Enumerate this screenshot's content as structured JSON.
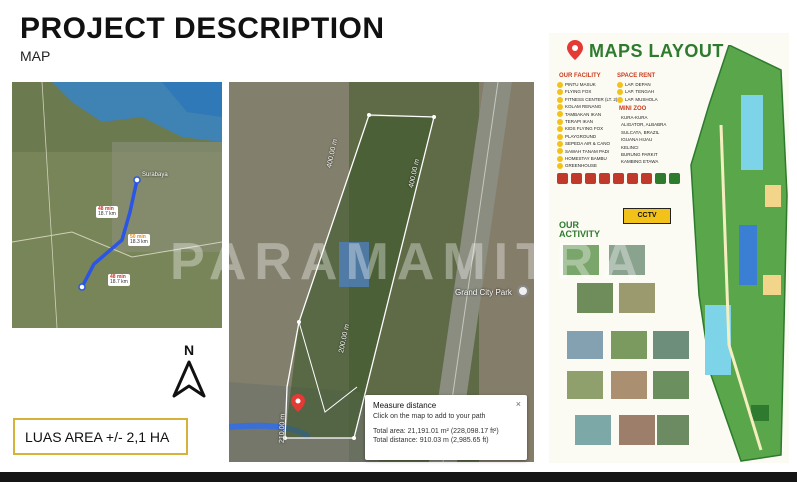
{
  "header": {
    "title": "PROJECT DESCRIPTION",
    "subtitle": "MAP"
  },
  "area_label": "LUAS AREA +/- 2,1 HA",
  "compass": {
    "label": "N"
  },
  "route_map": {
    "city_label": "Surabaya",
    "route_times": [
      {
        "time": "48 min",
        "distance": "18.7 km"
      },
      {
        "time": "50 min",
        "distance": "18.3 km"
      },
      {
        "time": "48 min",
        "distance": "18.7 km"
      }
    ]
  },
  "site_map": {
    "poi_label": "Grand City Park",
    "dimensions": [
      "400.00 m",
      "400.00 m",
      "200.00 m",
      "210.00 m"
    ],
    "measure": {
      "title": "Measure distance",
      "hint": "Click on the map to add to your path",
      "total_area": "Total area: 21,191.01 m² (228,098.17 ft²)",
      "total_distance": "Total distance: 910.03 m (2,985.65 ft)",
      "close": "×"
    }
  },
  "watermark": "PARAMAMITRA",
  "maps_layout": {
    "title": "MAPS LAYOUT",
    "facility_heading": "OUR FACILITY",
    "facilities": [
      "PINTU MASUK",
      "FLYING FOX",
      "FITNESS CENTER (LT. 2)",
      "KOLAM RENANG",
      "TAMBAKAN IKAN",
      "TERAPI IKAN",
      "KIDS FLYING FOX",
      "PLAYGROUND",
      "SEPEDA AIR & CANO",
      "SAWAH TANAM PADI",
      "HOMESTAY BAMBU",
      "GREENHOUSE"
    ],
    "space_heading": "SPACE RENT",
    "spaces": [
      "LAP. DEPAN",
      "LAP. TENGAH",
      "LAP. MUSHOLA"
    ],
    "zoo_heading": "MINI ZOO",
    "zoo": [
      "KURA-KURA",
      "ALIGATOR, ALBABRA",
      "SULCATA, BRAZIL",
      "IGUANA HIJAU",
      "KELINCI",
      "BURUNG PARKIT",
      "KAMBING ETAWA"
    ],
    "cctv": "CCTV",
    "activity_heading_1": "OUR",
    "activity_heading_2": "ACTIVITY"
  },
  "colors": {
    "accent_box": "#d7b23b",
    "route_blue": "#2a55e6",
    "layout_green": "#2e7a2e",
    "measure_line": "#ffffff"
  }
}
